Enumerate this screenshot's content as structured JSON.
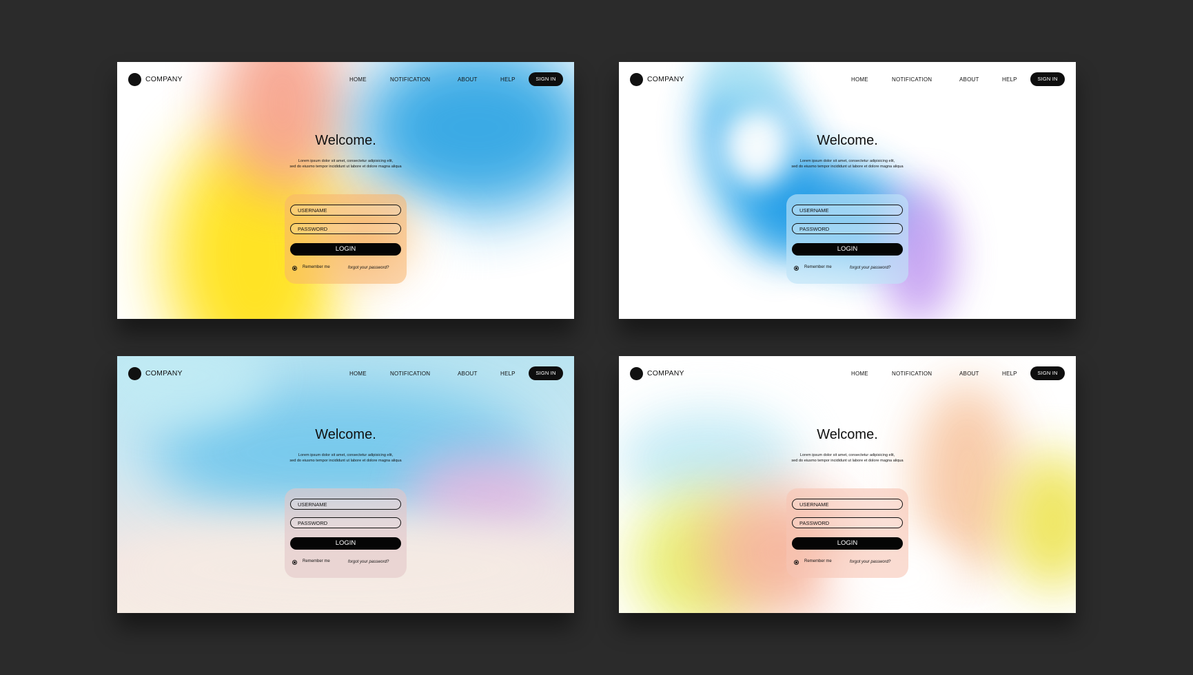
{
  "cards": [
    {
      "variant": "yellow-blue",
      "nav": {
        "company": "COMPANY",
        "home": "HOME",
        "notification": "NOTIFICATION",
        "about": "ABOUT",
        "help": "HELP",
        "sign_in": "SIGN IN"
      },
      "welcome": "Welcome.",
      "lorem_line1": "Lorem ipsum dolor sit amet, consectetur adipisicing elit,",
      "lorem_line2": "sed do eiusmo tempor incididunt ut labore et dolore magna aliqua",
      "login": {
        "username_placeholder": "USERNAME",
        "password_placeholder": "PASSWORD",
        "login_label": "LOGIN",
        "remember_me": "Remember me",
        "forgot_password": "forgot your password?"
      }
    },
    {
      "variant": "blue-swirl",
      "nav": {
        "company": "COMPANY",
        "home": "HOME",
        "notification": "NOTIFICATION",
        "about": "ABOUT",
        "help": "HELP",
        "sign_in": "SIGN IN"
      },
      "welcome": "Welcome.",
      "lorem_line1": "Lorem ipsum dolor sit amet, consectetur adipisicing elit,",
      "lorem_line2": "sed do eiusmo tempor incididunt ut labore et dolore magna aliqua",
      "login": {
        "username_placeholder": "USERNAME",
        "password_placeholder": "PASSWORD",
        "login_label": "LOGIN",
        "remember_me": "Remember me",
        "forgot_password": "forgot your password?"
      }
    },
    {
      "variant": "sky-pastel",
      "nav": {
        "company": "COMPANY",
        "home": "HOME",
        "notification": "NOTIFICATION",
        "about": "ABOUT",
        "help": "HELP",
        "sign_in": "SIGN IN"
      },
      "welcome": "Welcome.",
      "lorem_line1": "Lorem ipsum dolor sit amet, consectetur adipisicing elit,",
      "lorem_line2": "sed do eiusmo tempor incididunt ut labore et dolore magna aliqua",
      "login": {
        "username_placeholder": "USERNAME",
        "password_placeholder": "PASSWORD",
        "login_label": "LOGIN",
        "remember_me": "Remember me",
        "forgot_password": "forgot your password?"
      }
    },
    {
      "variant": "peach-lime",
      "nav": {
        "company": "COMPANY",
        "home": "HOME",
        "notification": "NOTIFICATION",
        "about": "ABOUT",
        "help": "HELP",
        "sign_in": "SIGN IN"
      },
      "welcome": "Welcome.",
      "lorem_line1": "Lorem ipsum dolor sit amet, consectetur adipisicing elit,",
      "lorem_line2": "sed do eiusmo tempor incididunt ut labore et dolore magna aliqua",
      "login": {
        "username_placeholder": "USERNAME",
        "password_placeholder": "PASSWORD",
        "login_label": "LOGIN",
        "remember_me": "Remember me",
        "forgot_password": "forgot your password?"
      }
    }
  ],
  "colors": {
    "page_background": "#2b2b2b",
    "button_black": "#0e0e0e",
    "text": "#111111"
  }
}
